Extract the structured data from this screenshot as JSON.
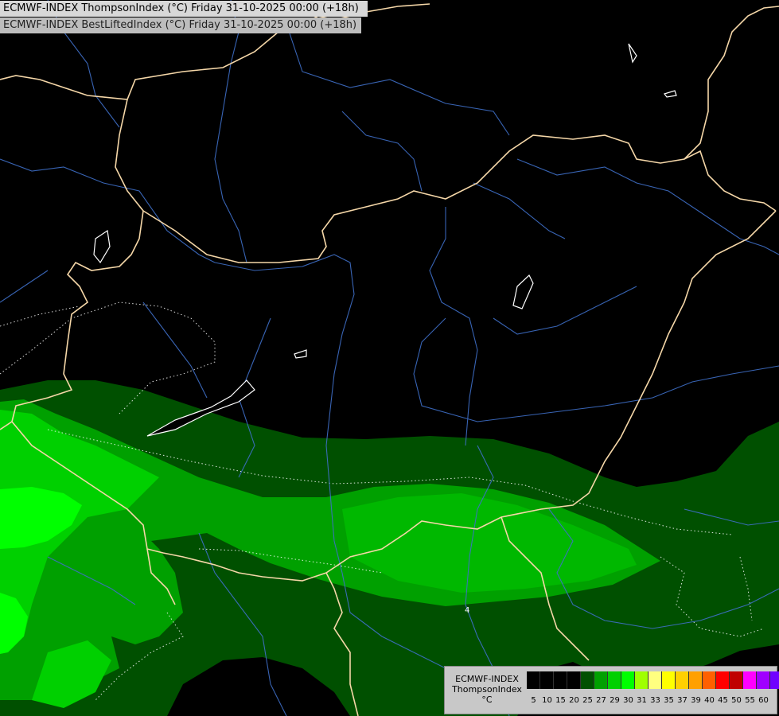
{
  "titles": {
    "line1": "ECMWF-INDEX ThompsonIndex (°C) Friday 31-10-2025 00:00 (+18h)",
    "line2": "ECMWF-INDEX BestLiftedIndex (°C) Friday 31-10-2025 00:00 (+18h)"
  },
  "legend": {
    "model": "ECMWF-INDEX",
    "parameter": "ThompsonIndex",
    "unit": "°C",
    "ticks": [
      "5",
      "10",
      "15",
      "20",
      "25",
      "27",
      "29",
      "30",
      "31",
      "33",
      "35",
      "37",
      "39",
      "40",
      "45",
      "50",
      "55",
      "60"
    ],
    "colors": [
      "#000000",
      "#000000",
      "#000000",
      "#000000",
      "#005000",
      "#00a000",
      "#00d000",
      "#00ff00",
      "#a0ff00",
      "#ffff80",
      "#ffff00",
      "#ffd000",
      "#ffa000",
      "#ff6000",
      "#ff0000",
      "#c00000",
      "#ff00ff",
      "#a000ff",
      "#7000ff",
      "#4000ff",
      "#0000ff"
    ]
  },
  "map": {
    "contour_label": "4",
    "palette": {
      "background": "#000000",
      "dark_green": "#005000",
      "mid_green": "#00a000",
      "bright_green": "#00d000",
      "lime": "#00ff00",
      "borders": "#f5d7a8",
      "rivers": "#3f6fc8",
      "contours": "#ffffff"
    }
  }
}
